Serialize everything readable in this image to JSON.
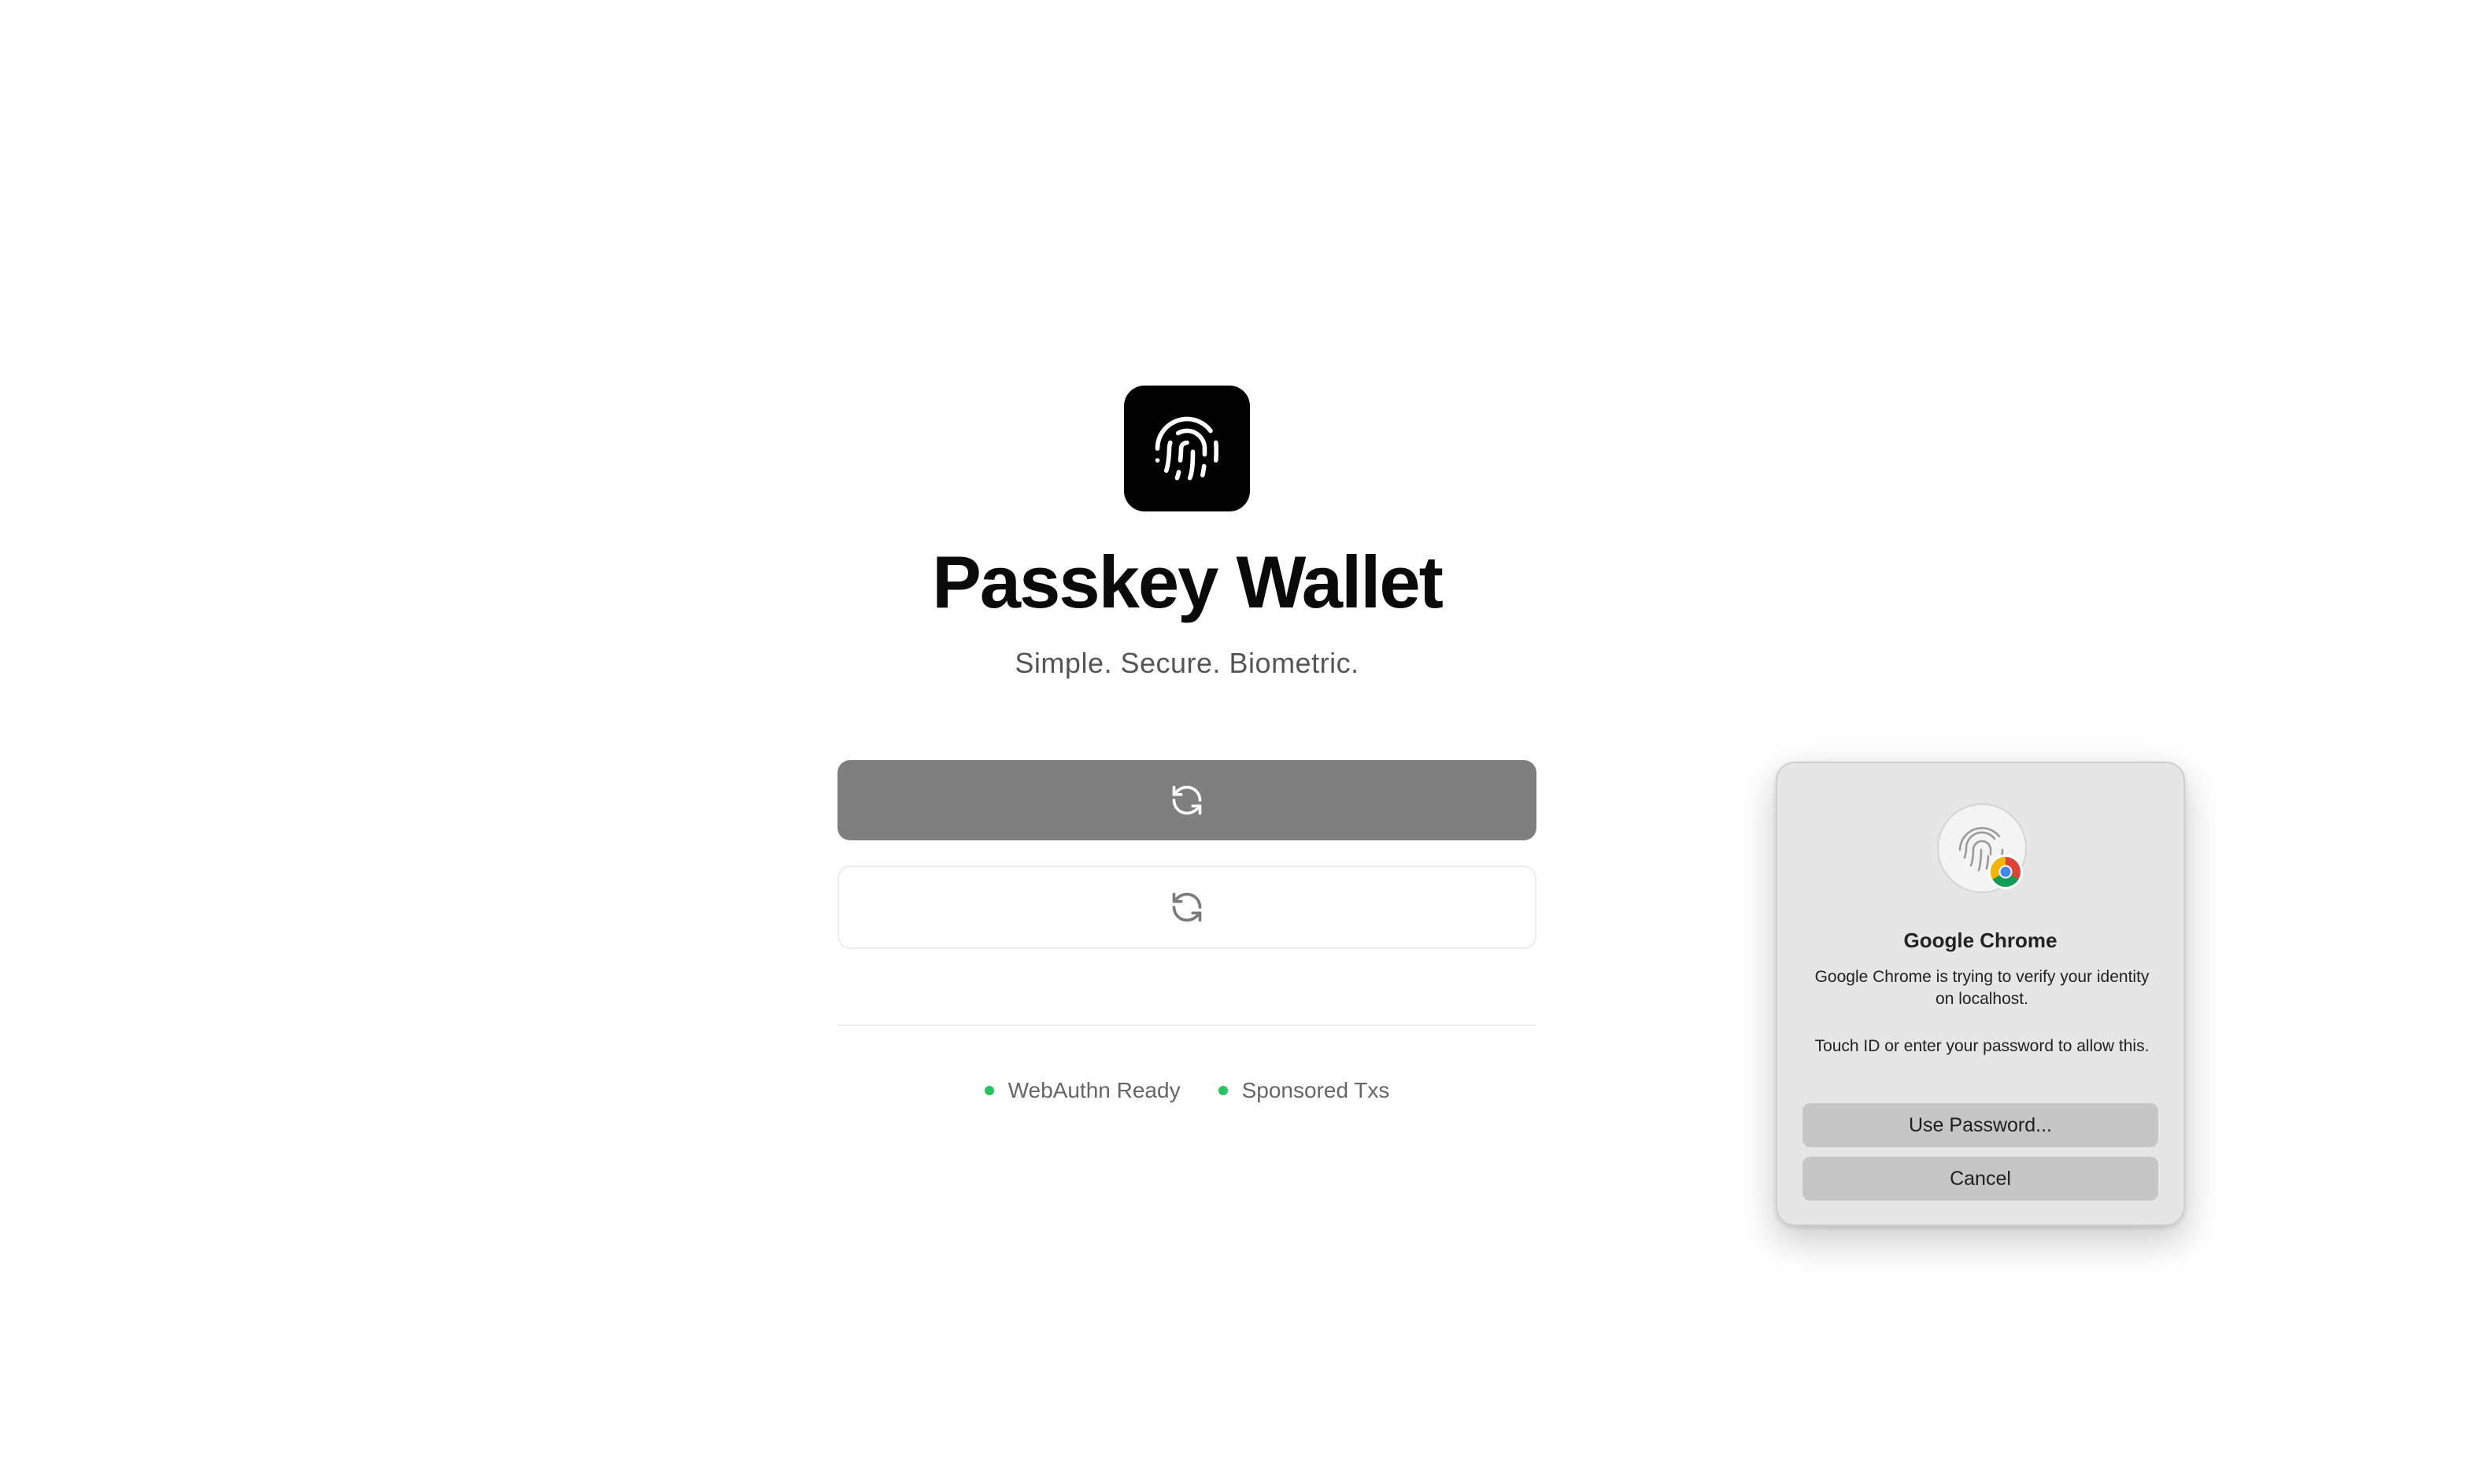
{
  "app": {
    "title": "Passkey Wallet",
    "tagline": "Simple. Secure. Biometric.",
    "logo_icon": "fingerprint-icon"
  },
  "actions": {
    "primary_icon": "refresh-icon",
    "secondary_icon": "refresh-icon"
  },
  "status": {
    "items": [
      {
        "label": "WebAuthn Ready",
        "color": "#22c55e"
      },
      {
        "label": "Sponsored Txs",
        "color": "#22c55e"
      }
    ]
  },
  "dialog": {
    "icon": "touch-id-fingerprint-icon",
    "badge_icon": "chrome-logo-icon",
    "title": "Google Chrome",
    "message": "Google Chrome is trying to verify your identity on localhost.",
    "instruction": "Touch ID or enter your password to allow this.",
    "use_password_label": "Use Password...",
    "cancel_label": "Cancel"
  },
  "colors": {
    "primary_button": "#7f7f7f",
    "logo_bg": "#000000",
    "status_dot": "#22c55e",
    "dialog_bg": "#e6e6e6"
  }
}
